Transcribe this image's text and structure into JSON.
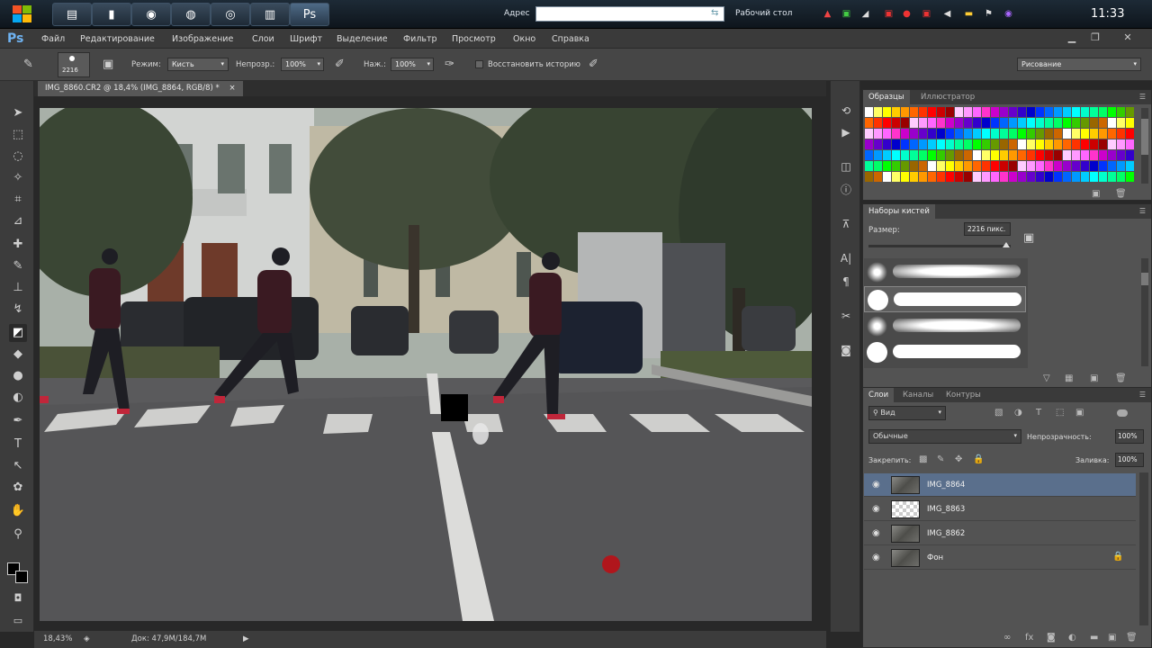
{
  "taskbar": {
    "address_label": "Адрес",
    "address_value": "",
    "desktop_label": "Рабочий стол",
    "clock": "11:33"
  },
  "app": {
    "logo": "Ps",
    "menu": [
      "Файл",
      "Редактирование",
      "Изображение",
      "Слои",
      "Шрифт",
      "Выделение",
      "Фильтр",
      "Просмотр",
      "Окно",
      "Справка"
    ]
  },
  "options": {
    "brush_size": "2216",
    "mode_label": "Режим:",
    "mode_value": "Кисть",
    "opacity_label": "Непрозр.:",
    "opacity_value": "100%",
    "flow_label": "Наж.:",
    "flow_value": "100%",
    "restore_history": "Восстановить историю",
    "workspace": "Рисование"
  },
  "document": {
    "tab_title": "IMG_8860.CR2 @ 18,4% (IMG_8864, RGB/8) *",
    "zoom": "18,43%",
    "doc_info": "Док: 47,9M/184,7M"
  },
  "swatches_panel": {
    "tabs": [
      "Образцы",
      "Иллюстратор"
    ],
    "colors": [
      "#ffffff",
      "#ffff66",
      "#ffff00",
      "#ffcc00",
      "#ff9900",
      "#ff6600",
      "#ff3300",
      "#ff0000",
      "#cc0000",
      "#990000",
      "#ffccff",
      "#ff99ff",
      "#ff66ff",
      "#ff33cc",
      "#cc00cc",
      "#9900cc",
      "#6600cc",
      "#3300cc",
      "#0000cc",
      "#0033ff",
      "#0066ff",
      "#0099ff",
      "#00ccff",
      "#00ffff",
      "#00ffcc",
      "#00ff99",
      "#00ff66",
      "#00ff00",
      "#33cc00",
      "#669900",
      "#996600",
      "#cc6600"
    ]
  },
  "brushes_panel": {
    "title": "Наборы кистей",
    "size_label": "Размер:",
    "size_value": "2216 пикс."
  },
  "layers_panel": {
    "tabs": [
      "Слои",
      "Каналы",
      "Контуры"
    ],
    "filter_label": "Вид",
    "blend_mode": "Обычные",
    "opacity_label": "Непрозрачность:",
    "opacity_value": "100%",
    "lock_label": "Закрепить:",
    "fill_label": "Заливка:",
    "fill_value": "100%",
    "layers": [
      {
        "name": "IMG_8864",
        "selected": true
      },
      {
        "name": "IMG_8863",
        "selected": false
      },
      {
        "name": "IMG_8862",
        "selected": false
      },
      {
        "name": "Фон",
        "selected": false
      }
    ]
  }
}
